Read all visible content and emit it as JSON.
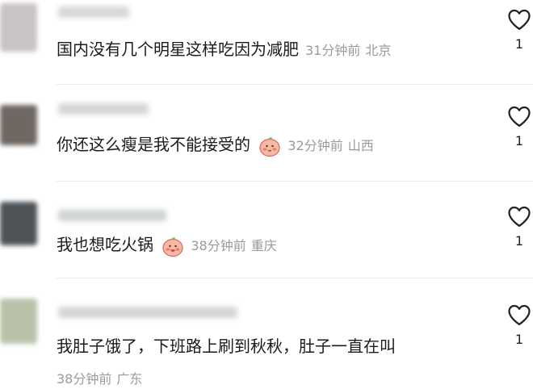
{
  "comments": [
    {
      "text": "国内没有几个明星这样吃因为减肥",
      "time": "31分钟前",
      "location": "北京",
      "likes": "1",
      "avatar_color": "#c9c2c6",
      "username_color": "#d8d6d7",
      "has_emoji": false
    },
    {
      "text": "你还这么瘦是我不能接受的",
      "time": "32分钟前",
      "location": "山西",
      "likes": "1",
      "avatar_color": "#6f6762",
      "username_color": "#d6d4d3",
      "has_emoji": true
    },
    {
      "text": "我也想吃火锅",
      "time": "38分钟前",
      "location": "重庆",
      "likes": "1",
      "avatar_color": "#4d5357",
      "username_color": "#cfd2d2",
      "has_emoji": true
    },
    {
      "text": "我肚子饿了，下班路上刷到秋秋，肚子一直在叫",
      "time": "38分钟前",
      "location": "广东",
      "likes": "1",
      "avatar_color": "#b9c2a9",
      "username_color": "#d5d5d6",
      "has_emoji": false
    }
  ],
  "icons": {
    "like": "heart-outline-icon",
    "emoji": "peach-blush-emoji-icon"
  },
  "colors": {
    "text": "#1b1b1b",
    "meta": "#9a9a9a",
    "divider": "#ececec"
  }
}
